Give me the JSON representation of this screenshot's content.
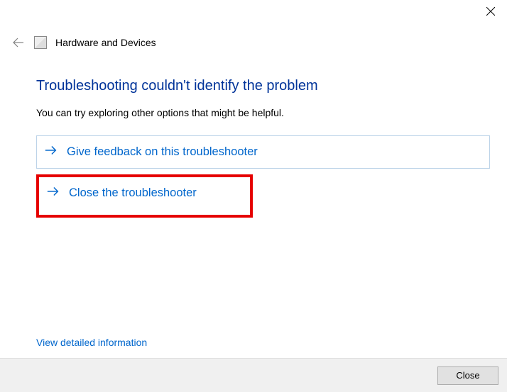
{
  "titlebar": {
    "close_icon": "close-icon"
  },
  "header": {
    "back_icon": "back-arrow-icon",
    "app_icon": "hardware-devices-icon",
    "title": "Hardware and Devices"
  },
  "content": {
    "heading": "Troubleshooting couldn't identify the problem",
    "sub_text": "You can try exploring other options that might be helpful.",
    "options": [
      {
        "label": "Give feedback on this troubleshooter"
      },
      {
        "label": "Close the troubleshooter"
      }
    ],
    "detailed_link": "View detailed information"
  },
  "footer": {
    "close_label": "Close"
  }
}
